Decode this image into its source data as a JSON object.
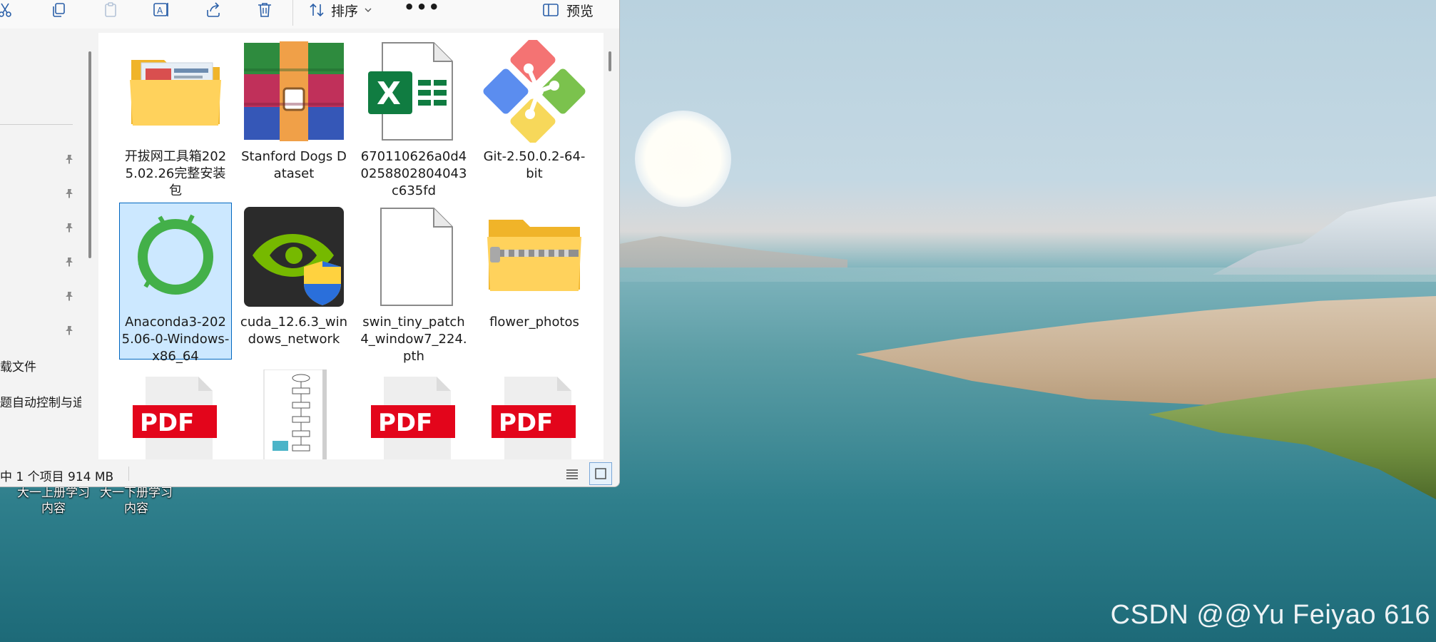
{
  "toolbar": {
    "sort_label": "排序",
    "preview_label": "预览",
    "more_label": "•••"
  },
  "nav": {
    "items": [
      {
        "label": "载文件"
      },
      {
        "label": "题自动控制与追"
      }
    ]
  },
  "files": [
    {
      "name": "开拔网工具箱2025.02.26完整安装包",
      "icon": "folder-icon"
    },
    {
      "name": "Stanford Dogs Dataset",
      "icon": "winrar-archive-icon"
    },
    {
      "name": "670110626a0d40258802804043c635fd",
      "icon": "excel-file-icon"
    },
    {
      "name": "Git-2.50.0.2-64-bit",
      "icon": "git-installer-icon"
    },
    {
      "name": "Anaconda3-2025.06-0-Windows-x86_64",
      "icon": "anaconda-icon",
      "selected": true
    },
    {
      "name": "cuda_12.6.3_windows_network",
      "icon": "nvidia-installer-icon"
    },
    {
      "name": "swin_tiny_patch4_window7_224.pth",
      "icon": "blank-file-icon"
    },
    {
      "name": "flower_photos",
      "icon": "zip-folder-icon"
    },
    {
      "name": "",
      "icon": "pdf-file-icon"
    },
    {
      "name": "",
      "icon": "flowchart-image-icon"
    },
    {
      "name": "",
      "icon": "pdf-file-icon"
    },
    {
      "name": "",
      "icon": "pdf-file-icon"
    }
  ],
  "pdf_badge": "PDF",
  "status": {
    "text": "中 1 个项目  914 MB"
  },
  "desktop": {
    "icons": [
      {
        "label": "大一上册学习内容"
      },
      {
        "label": "大一下册学习内容"
      }
    ]
  },
  "watermark": "CSDN @@Yu Feiyao 616",
  "colors": {
    "accent": "#0067c0",
    "selection": "#cce8ff",
    "pdf_red": "#e3051b"
  }
}
